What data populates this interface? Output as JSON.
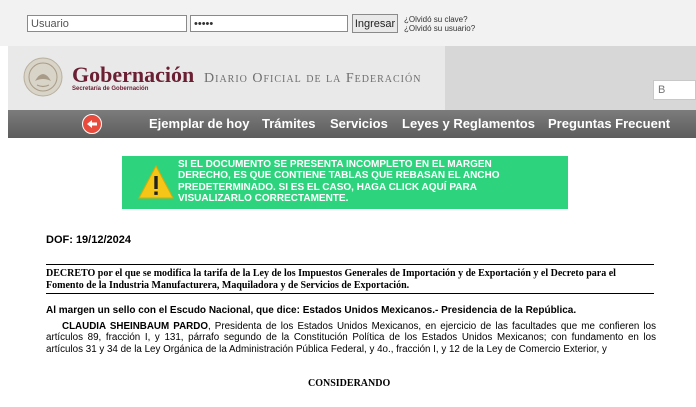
{
  "login": {
    "user_placeholder": "Usuario",
    "password_value": "•••••",
    "submit_label": "Ingresar",
    "forgot_password": "¿Olvidó su clave?",
    "forgot_user": "¿Olvidó su usuario?"
  },
  "header": {
    "brand_name": "Gobernación",
    "brand_sub": "Secretaría de Gobernación",
    "publication": "Diario Oficial de la Federación",
    "search_stub": "B"
  },
  "nav": {
    "items": [
      "Ejemplar de hoy",
      "Trámites",
      "Servicios",
      "Leyes y Reglamentos",
      "Preguntas Frecuent"
    ]
  },
  "warning": {
    "lines": [
      "SI EL DOCUMENTO SE PRESENTA INCOMPLETO EN EL MARGEN",
      "DERECHO, ES QUE CONTIENE TABLAS QUE REBASAN EL ANCHO",
      "PREDETERMINADO. SI ES EL CASO, HAGA CLICK AQUÍ PARA",
      "VISUALIZARLO CORRECTAMENTE."
    ]
  },
  "document": {
    "date": "DOF: 19/12/2024",
    "title": "DECRETO por el que se modifica la tarifa de la Ley de los Impuestos Generales de Importación y de Exportación y el Decreto para el Fomento de la Industria Manufacturera, Maquiladora y de Servicios de Exportación.",
    "margin_note": "Al margen un sello con el Escudo Nacional, que dice: Estados Unidos Mexicanos.- Presidencia de la República.",
    "author": "CLAUDIA SHEINBAUM PARDO",
    "body": ", Presidenta de los Estados Unidos Mexicanos, en ejercicio de las facultades que me confieren los artículos 89, fracción I, y 131, párrafo segundo de la Constitución Política de los Estados Unidos Mexicanos; con fundamento en los artículos 31 y 34 de la Ley Orgánica de la Administración Pública Federal, y 4o., fracción I, y 12 de la Ley de Comercio Exterior, y",
    "section_heading": "CONSIDERANDO"
  },
  "colors": {
    "brand": "#6b1f33",
    "nav_bg": "#6a6a6a",
    "warning_bg": "#2ed47d",
    "warning_icon": "#f5c518",
    "back_button": "#e84b3c"
  }
}
